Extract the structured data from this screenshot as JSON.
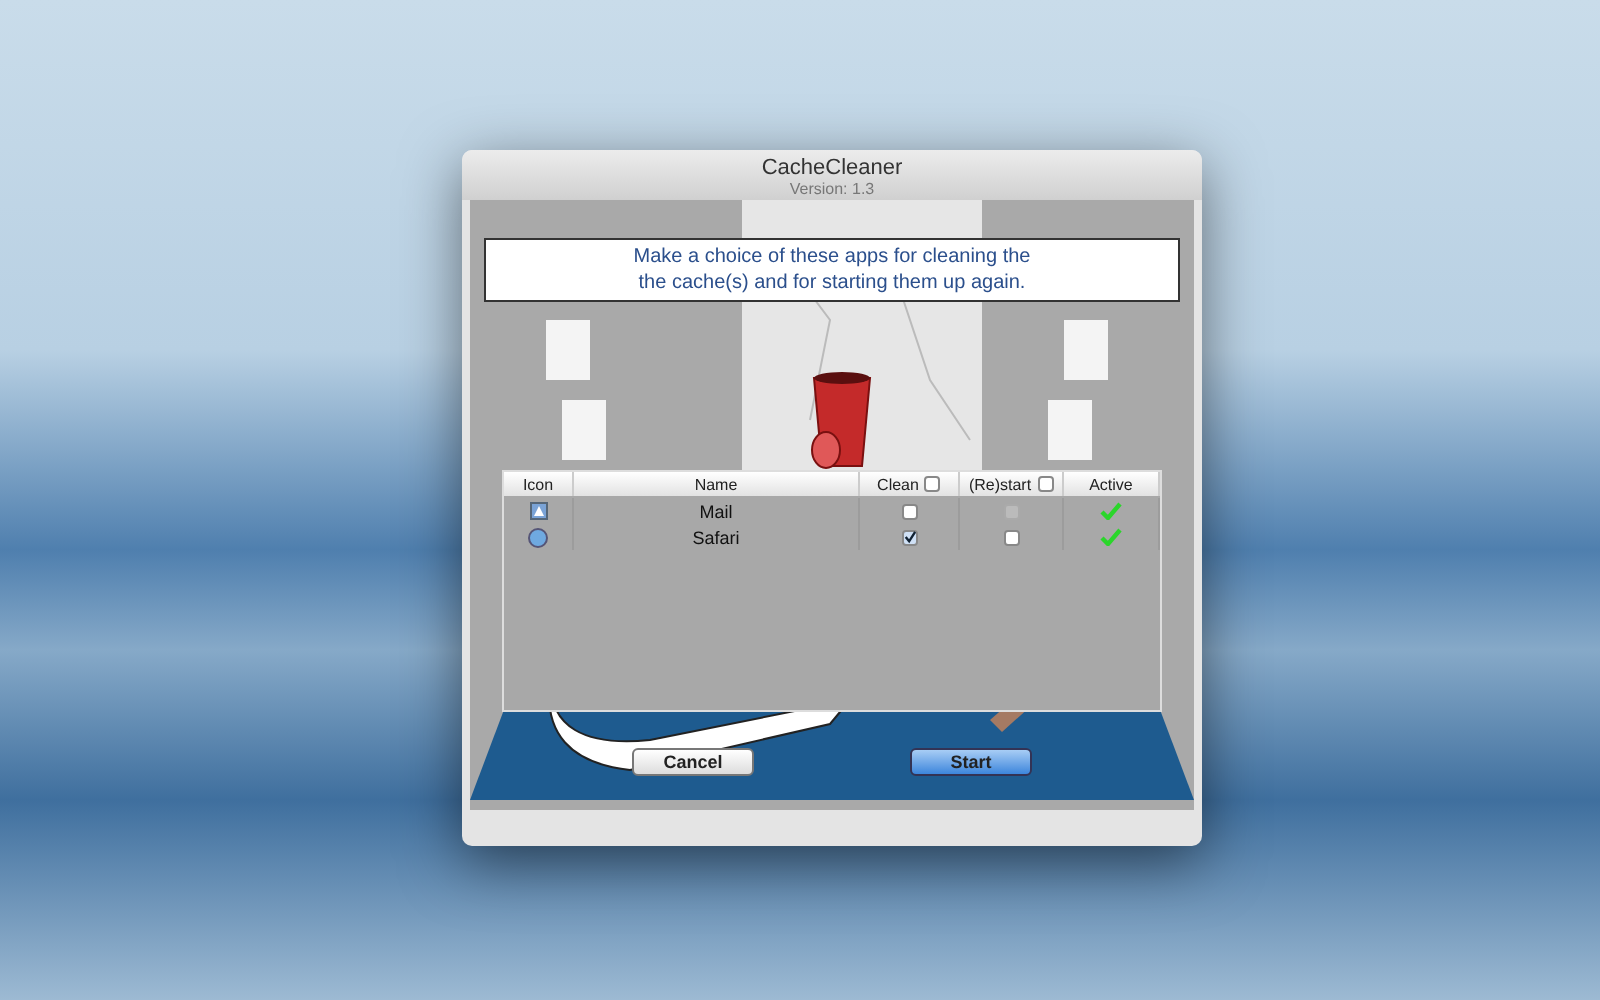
{
  "window": {
    "title": "CacheCleaner",
    "subtitle": "Version: 1.3"
  },
  "banner": "Make a choice of these apps for cleaning the\nthe cache(s) and for starting them up again.",
  "table": {
    "columns": [
      {
        "kind": "text",
        "label": "Icon"
      },
      {
        "kind": "text",
        "label": "Name"
      },
      {
        "kind": "checkbox",
        "label": "Clean",
        "checked": false
      },
      {
        "kind": "checkbox",
        "label": "(Re)start",
        "checked": false
      },
      {
        "kind": "text",
        "label": "Active"
      }
    ],
    "rows": [
      {
        "kind": "mail",
        "name": "Mail",
        "clean": false,
        "restart": false,
        "restart_disabled": true,
        "active": true
      },
      {
        "kind": "safari",
        "name": "Safari",
        "clean": true,
        "restart": false,
        "restart_disabled": false,
        "active": true
      }
    ]
  },
  "buttons": [
    {
      "label": "Cancel",
      "kind": "normal"
    },
    {
      "label": "Start",
      "kind": "default"
    }
  ]
}
